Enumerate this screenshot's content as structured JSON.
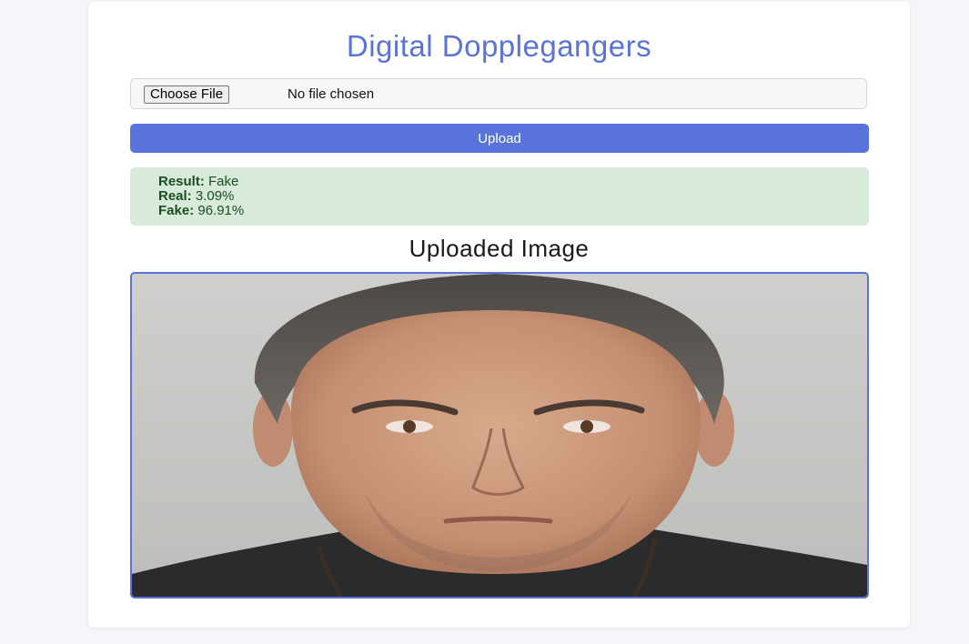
{
  "page": {
    "title": "Digital Dopplegangers"
  },
  "file_input": {
    "button_label": "Choose File",
    "status_text": "No file chosen"
  },
  "upload": {
    "label": "Upload"
  },
  "result": {
    "result_label": "Result:",
    "result_value": "Fake",
    "real_label": "Real:",
    "real_value": "3.09%",
    "fake_label": "Fake:",
    "fake_value": "96.91%"
  },
  "image_section": {
    "heading": "Uploaded Image"
  },
  "colors": {
    "accent": "#5873da",
    "title": "#5b73d6",
    "result_bg": "#d8ead9",
    "result_text": "#1d4d24"
  }
}
